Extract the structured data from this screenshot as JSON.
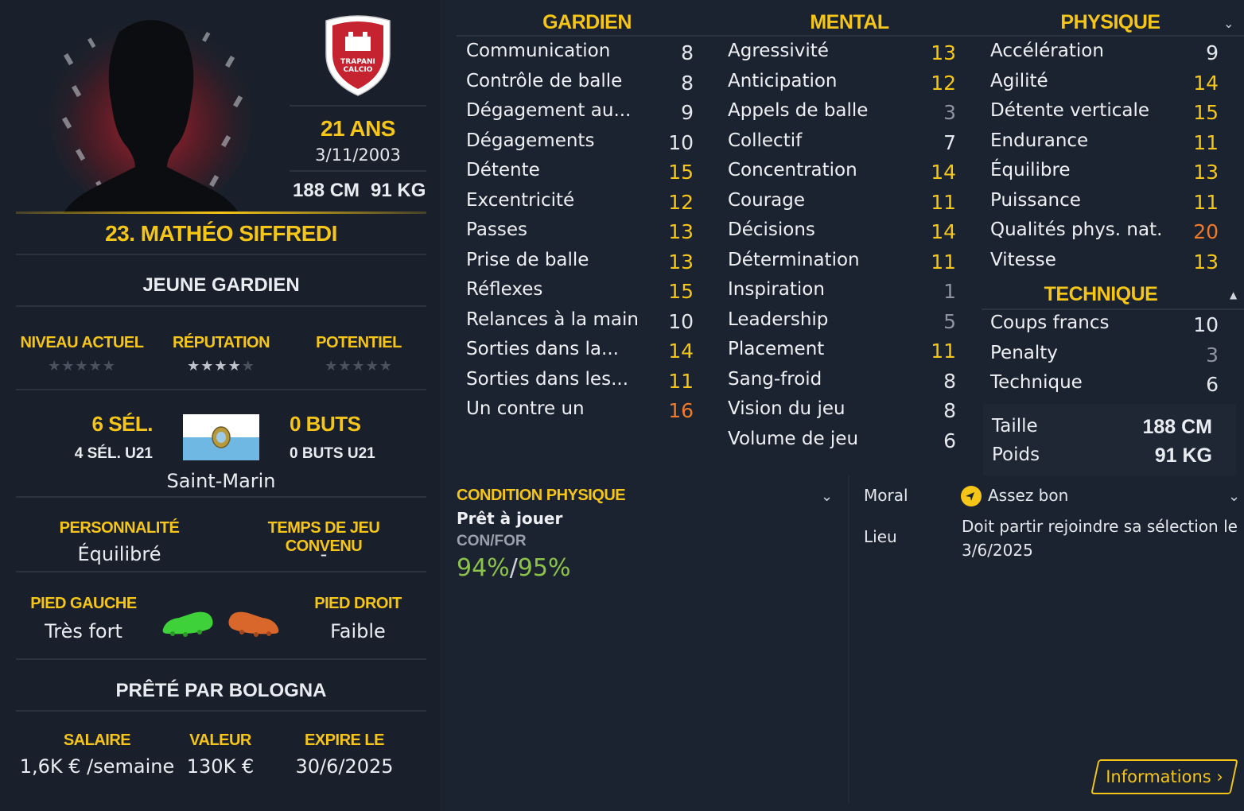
{
  "player": {
    "age": "21 ANS",
    "birth_date": "3/11/2003",
    "height": "188 CM",
    "weight": "91 KG",
    "name": "23. MATHÉO SIFFREDI",
    "role": "JEUNE GARDIEN",
    "club_badge_text": [
      "TRAPANI",
      "CALCIO"
    ]
  },
  "ratings": {
    "current_label": "NIVEAU ACTUEL",
    "current_stars": 0,
    "reputation_label": "RÉPUTATION",
    "reputation_stars": 3.5,
    "potential_label": "POTENTIEL",
    "potential_stars": 0
  },
  "international": {
    "caps": "6 SÉL.",
    "caps_u21": "4 SÉL. U21",
    "goals": "0 BUTS",
    "goals_u21": "0 BUTS U21",
    "country": "Saint-Marin"
  },
  "personality": {
    "label": "PERSONNALITÉ",
    "value": "Équilibré",
    "playtime_label": "TEMPS DE JEU CONVENU",
    "playtime_value": "-"
  },
  "feet": {
    "left_label": "PIED GAUCHE",
    "left_value": "Très fort",
    "right_label": "PIED DROIT",
    "right_value": "Faible",
    "left_color": "#3fd13a",
    "right_color": "#d9662a"
  },
  "loan": {
    "text": "PRÊTÉ PAR BOLOGNA"
  },
  "contract": {
    "salary_label": "SALAIRE",
    "salary_value": "1,6K € /semaine",
    "value_label": "VALEUR",
    "value_value": "130K €",
    "expires_label": "EXPIRE LE",
    "expires_value": "30/6/2025"
  },
  "attributes": {
    "goalkeeping": {
      "title": "GARDIEN",
      "items": [
        {
          "name": "Communication",
          "value": "8"
        },
        {
          "name": "Contrôle de balle",
          "value": "8"
        },
        {
          "name": "Dégagement au...",
          "value": "9"
        },
        {
          "name": "Dégagements",
          "value": "10"
        },
        {
          "name": "Détente",
          "value": "15"
        },
        {
          "name": "Excentricité",
          "value": "12"
        },
        {
          "name": "Passes",
          "value": "13"
        },
        {
          "name": "Prise de balle",
          "value": "13"
        },
        {
          "name": "Réflexes",
          "value": "15"
        },
        {
          "name": "Relances à la main",
          "value": "10"
        },
        {
          "name": "Sorties dans la...",
          "value": "14"
        },
        {
          "name": "Sorties dans les...",
          "value": "11"
        },
        {
          "name": "Un contre un",
          "value": "16"
        }
      ]
    },
    "mental": {
      "title": "MENTAL",
      "items": [
        {
          "name": "Agressivité",
          "value": "13"
        },
        {
          "name": "Anticipation",
          "value": "12"
        },
        {
          "name": "Appels de balle",
          "value": "3"
        },
        {
          "name": "Collectif",
          "value": "7"
        },
        {
          "name": "Concentration",
          "value": "14"
        },
        {
          "name": "Courage",
          "value": "11"
        },
        {
          "name": "Décisions",
          "value": "14"
        },
        {
          "name": "Détermination",
          "value": "11"
        },
        {
          "name": "Inspiration",
          "value": "1"
        },
        {
          "name": "Leadership",
          "value": "5"
        },
        {
          "name": "Placement",
          "value": "11"
        },
        {
          "name": "Sang-froid",
          "value": "8"
        },
        {
          "name": "Vision du jeu",
          "value": "8"
        },
        {
          "name": "Volume de jeu",
          "value": "6"
        }
      ]
    },
    "physical": {
      "title": "PHYSIQUE",
      "items": [
        {
          "name": "Accélération",
          "value": "9"
        },
        {
          "name": "Agilité",
          "value": "14"
        },
        {
          "name": "Détente verticale",
          "value": "15"
        },
        {
          "name": "Endurance",
          "value": "11"
        },
        {
          "name": "Équilibre",
          "value": "13"
        },
        {
          "name": "Puissance",
          "value": "11"
        },
        {
          "name": "Qualités phys. nat.",
          "value": "20"
        },
        {
          "name": "Vitesse",
          "value": "13"
        }
      ]
    },
    "technical": {
      "title": "TECHNIQUE",
      "items": [
        {
          "name": "Coups francs",
          "value": "10"
        },
        {
          "name": "Penalty",
          "value": "3"
        },
        {
          "name": "Technique",
          "value": "6"
        }
      ]
    },
    "height_label": "Taille",
    "height_value": "188 CM",
    "weight_label": "Poids",
    "weight_value": "91 KG"
  },
  "condition": {
    "title": "CONDITION PHYSIQUE",
    "status": "Prêt à jouer",
    "sub_label": "CON/FOR",
    "con": "94%",
    "sep": "/",
    "for": "95%"
  },
  "morale": {
    "label": "Moral",
    "value": "Assez bon",
    "location_label": "Lieu",
    "location_value": "Doit partir rejoindre sa sélection le 3/6/2025"
  },
  "button": {
    "label": "Informations"
  },
  "colors": {
    "accent": "#f5c518",
    "background": "#1c2330",
    "attr_low": "#8d949f",
    "attr_high": "#f5c518",
    "attr_top": "#f07a2a",
    "condition_green": "#8bc34a"
  }
}
